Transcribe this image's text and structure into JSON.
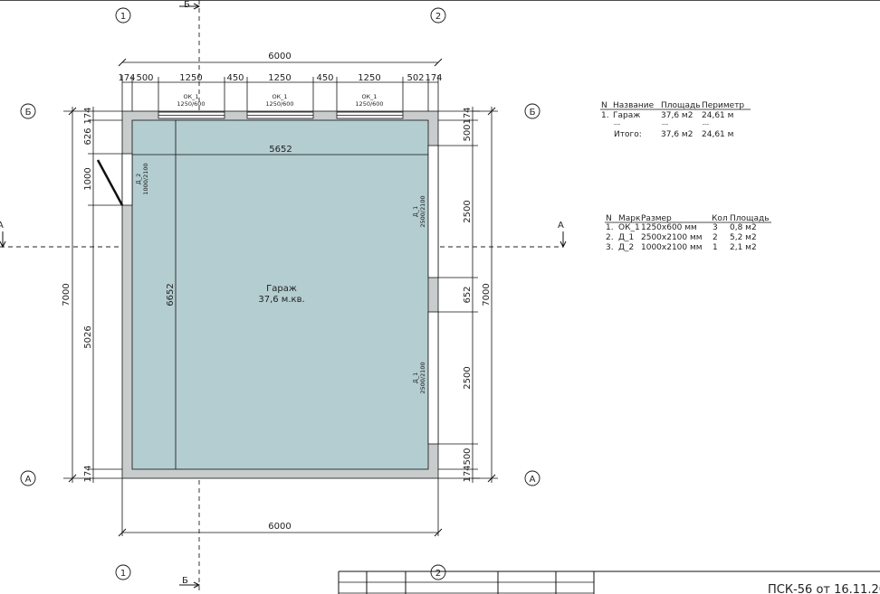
{
  "colors": {
    "room_fill": "#b4cdd0",
    "wall": "#c9cccd",
    "ink": "#111111"
  },
  "axes": {
    "one": "1",
    "two": "2",
    "a": "А",
    "b": "Б"
  },
  "section_marks": {
    "a": "А",
    "b": "Б"
  },
  "dimensions": {
    "top_total": "6000",
    "top_chain": [
      "174",
      "500",
      "1250",
      "450",
      "1250",
      "450",
      "1250",
      "502",
      "174"
    ],
    "bottom_total": "6000",
    "left_total": "7000",
    "left_chain": [
      "174",
      "626",
      "1000",
      "5026",
      "174"
    ],
    "right_total": "7000",
    "right_chain": [
      "174",
      "500",
      "2500",
      "652",
      "2500",
      "500",
      "174"
    ],
    "inner_width": "5652",
    "inner_height": "6652"
  },
  "openings": {
    "windows": [
      {
        "mark": "ОК_1",
        "size": "1250/600"
      },
      {
        "mark": "ОК_1",
        "size": "1250/600"
      },
      {
        "mark": "ОК_1",
        "size": "1250/600"
      }
    ],
    "door_left": {
      "mark": "Д_2",
      "size": "1000/2100"
    },
    "doors_right": [
      {
        "mark": "Д_1",
        "size": "2500/2100"
      },
      {
        "mark": "Д_1",
        "size": "2500/2100"
      }
    ]
  },
  "room": {
    "name": "Гараж",
    "area": "37,6 м.кв."
  },
  "rooms_table": {
    "headers": [
      "N",
      "Название",
      "Площадь",
      "Периметр"
    ],
    "rows": [
      [
        "1.",
        "Гараж",
        "37,6 м2",
        "24,61 м"
      ]
    ],
    "separator": [
      "---",
      "---",
      "---"
    ],
    "total": [
      "Итого:",
      "37,6 м2",
      "24,61 м"
    ]
  },
  "openings_table": {
    "headers": [
      "N",
      "Марк",
      "Размер",
      "Кол",
      "Площадь"
    ],
    "rows": [
      [
        "1.",
        "ОК_1",
        "1250х600 мм",
        "3",
        "0,8 м2"
      ],
      [
        "2.",
        "Д_1",
        "2500х2100 мм",
        "2",
        "5,2 м2"
      ],
      [
        "3.",
        "Д_2",
        "1000х2100 мм",
        "1",
        "2,1 м2"
      ]
    ]
  },
  "title_block": {
    "code": "ПСК-56 от 16.11.20"
  }
}
